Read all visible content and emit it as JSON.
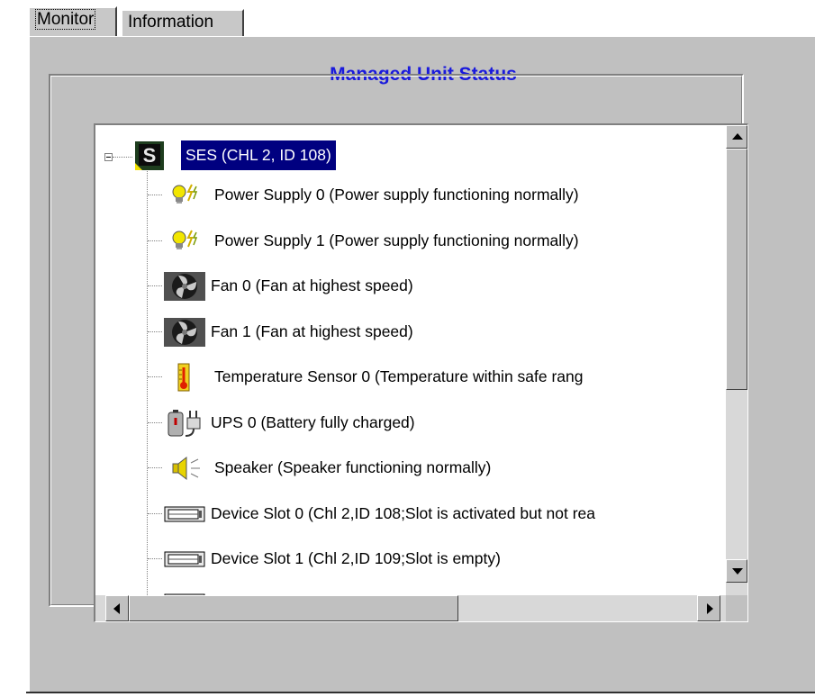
{
  "tabs": [
    {
      "label": "Monitor",
      "selected": true
    },
    {
      "label": "Information",
      "selected": false
    }
  ],
  "panel": {
    "title": "Managed Unit Status"
  },
  "tree": {
    "root": {
      "label": "SES (CHL 2, ID 108)",
      "icon": "ses-enclosure-icon",
      "expanded": true,
      "selected": true
    },
    "items": [
      {
        "label": "Power Supply 0 (Power supply functioning normally)",
        "icon": "power-supply-icon"
      },
      {
        "label": "Power Supply 1 (Power supply functioning normally)",
        "icon": "power-supply-icon"
      },
      {
        "label": "Fan 0 (Fan at highest speed)",
        "icon": "fan-icon"
      },
      {
        "label": "Fan 1 (Fan at highest speed)",
        "icon": "fan-icon"
      },
      {
        "label": "Temperature Sensor 0 (Temperature within safe rang",
        "icon": "thermometer-icon"
      },
      {
        "label": "UPS 0 (Battery fully charged)",
        "icon": "ups-battery-icon"
      },
      {
        "label": "Speaker (Speaker functioning normally)",
        "icon": "speaker-icon"
      },
      {
        "label": "Device Slot 0 (Chl 2,ID 108;Slot is activated but not rea",
        "icon": "device-slot-icon"
      },
      {
        "label": "Device Slot 1 (Chl 2,ID 109;Slot is empty)",
        "icon": "device-slot-icon"
      }
    ]
  },
  "colors": {
    "title": "#1a1adc",
    "selection": "#000080",
    "panel": "#c0c0c0"
  }
}
